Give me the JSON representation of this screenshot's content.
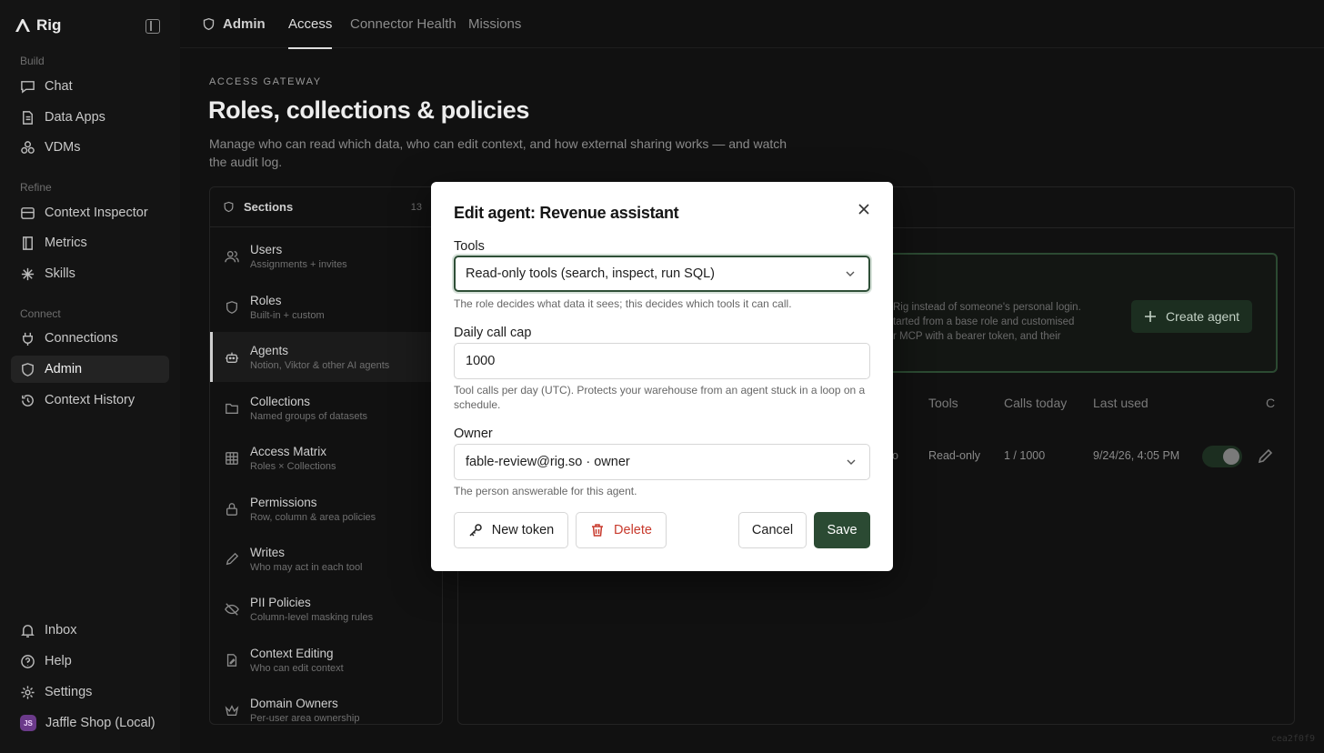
{
  "app": {
    "name": "Rig",
    "workspace": "Jaffle Shop (Local)",
    "workspace_initials": "JS"
  },
  "sidebar": {
    "groups": [
      {
        "label": "Build",
        "items": [
          {
            "label": "Chat",
            "icon": "chat-icon"
          },
          {
            "label": "Data Apps",
            "icon": "document-icon"
          },
          {
            "label": "VDMs",
            "icon": "cubes-icon"
          }
        ]
      },
      {
        "label": "Refine",
        "items": [
          {
            "label": "Context Inspector",
            "icon": "layers-icon"
          },
          {
            "label": "Metrics",
            "icon": "book-icon"
          },
          {
            "label": "Skills",
            "icon": "sparkle-icon"
          }
        ]
      },
      {
        "label": "Connect",
        "items": [
          {
            "label": "Connections",
            "icon": "plug-icon"
          },
          {
            "label": "Admin",
            "icon": "shield-icon",
            "active": true
          },
          {
            "label": "Context History",
            "icon": "history-icon"
          }
        ]
      }
    ],
    "footer": [
      {
        "label": "Inbox",
        "icon": "bell-icon"
      },
      {
        "label": "Help",
        "icon": "help-icon"
      },
      {
        "label": "Settings",
        "icon": "gear-icon"
      }
    ]
  },
  "topbar": {
    "section": "Admin",
    "tabs": [
      {
        "label": "Access",
        "active": true
      },
      {
        "label": "Connector Health"
      },
      {
        "label": "Missions"
      }
    ]
  },
  "page": {
    "eyebrow": "ACCESS GATEWAY",
    "title": "Roles, collections & policies",
    "description": "Manage who can read which data, who can edit context, and how external sharing works — and watch the audit log."
  },
  "sections": {
    "title": "Sections",
    "count": "13",
    "items": [
      {
        "title": "Users",
        "subtitle": "Assignments + invites",
        "icon": "users-icon"
      },
      {
        "title": "Roles",
        "subtitle": "Built-in + custom",
        "icon": "shield-icon"
      },
      {
        "title": "Agents",
        "subtitle": "Notion, Viktor & other AI agents",
        "icon": "bot-icon",
        "active": true
      },
      {
        "title": "Collections",
        "subtitle": "Named groups of datasets",
        "icon": "folder-icon"
      },
      {
        "title": "Access Matrix",
        "subtitle": "Roles × Collections",
        "icon": "grid-icon"
      },
      {
        "title": "Permissions",
        "subtitle": "Row, column & area policies",
        "icon": "lock-icon"
      },
      {
        "title": "Writes",
        "subtitle": "Who may act in each tool",
        "icon": "pencil-icon"
      },
      {
        "title": "PII Policies",
        "subtitle": "Column-level masking rules",
        "icon": "eye-off-icon"
      },
      {
        "title": "Context Editing",
        "subtitle": "Who can edit context",
        "icon": "file-edit-icon"
      },
      {
        "title": "Domain Owners",
        "subtitle": "Per-user area ownership",
        "icon": "crown-icon"
      }
    ]
  },
  "agents_panel": {
    "info_lines": [
      "Rig instead of someone's personal login.",
      "tarted from a base role and customised",
      "r MCP with a bearer token, and their"
    ],
    "create_button": "Create agent",
    "columns": [
      "Tools",
      "Calls today",
      "Last used",
      "C"
    ],
    "row": {
      "partial": "o",
      "tools": "Read-only",
      "calls": "1 / 1000",
      "last_used": "9/24/26, 4:05 PM",
      "enabled": true
    }
  },
  "build_id": "cea2f0f9",
  "modal": {
    "title": "Edit agent: Revenue assistant",
    "tools_label": "Tools",
    "tools_value": "Read-only tools (search, inspect, run SQL)",
    "tools_help": "The role decides what data it sees; this decides which tools it can call.",
    "cap_label": "Daily call cap",
    "cap_value": "1000",
    "cap_help": "Tool calls per day (UTC). Protects your warehouse from an agent stuck in a loop on a schedule.",
    "owner_label": "Owner",
    "owner_value": "fable-review@rig.so · owner",
    "owner_help": "The person answerable for this agent.",
    "buttons": {
      "new_token": "New token",
      "delete": "Delete",
      "cancel": "Cancel",
      "save": "Save"
    }
  },
  "colors": {
    "accent": "#2b4a33",
    "danger": "#c83a2d",
    "overlay": "#0a0a0a"
  }
}
